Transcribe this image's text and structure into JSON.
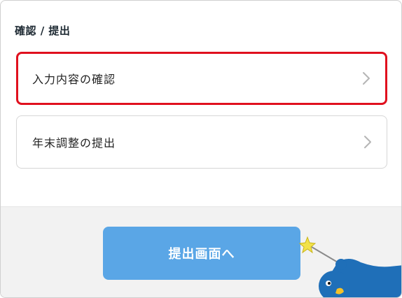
{
  "section": {
    "title": "確認 / 提出"
  },
  "menu": {
    "items": [
      {
        "label": "入力内容の確認",
        "highlighted": true
      },
      {
        "label": "年末調整の提出",
        "highlighted": false
      }
    ]
  },
  "footer": {
    "submit_label": "提出画面へ"
  },
  "colors": {
    "highlight_border": "#e0101e",
    "submit_button": "#5aa6e6",
    "mascot": "#1f6fb8"
  },
  "icons": {
    "chevron": "chevron-right-icon",
    "mascot": "bird-mascot-icon"
  }
}
